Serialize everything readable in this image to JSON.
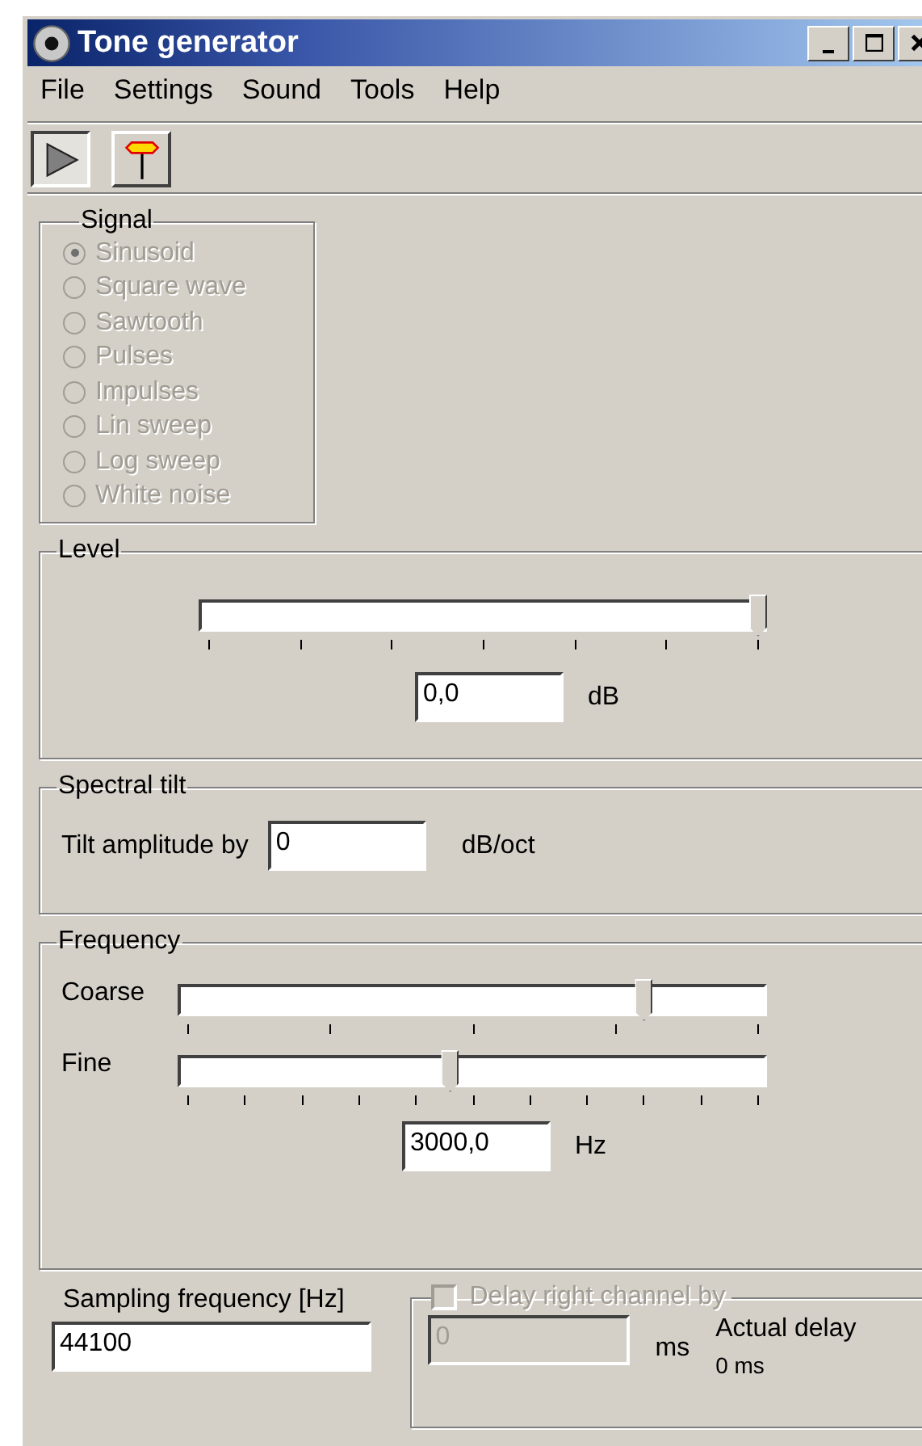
{
  "window": {
    "title": "Tone generator"
  },
  "menu": [
    "File",
    "Settings",
    "Sound",
    "Tools",
    "Help"
  ],
  "toolbar": [
    {
      "kind": "play",
      "pressed": true
    },
    {
      "kind": "signpost",
      "pressed": false
    }
  ],
  "signal": {
    "title": "Signal",
    "disabled": true,
    "options": [
      {
        "label": "Sinusoid",
        "selected": true
      },
      {
        "label": "Square wave",
        "selected": false
      },
      {
        "label": "Sawtooth",
        "selected": false
      },
      {
        "label": "Pulses",
        "selected": false
      },
      {
        "label": "Impulses",
        "selected": false
      },
      {
        "label": "Lin sweep",
        "selected": false
      },
      {
        "label": "Log sweep",
        "selected": false
      },
      {
        "label": "White noise",
        "selected": false
      }
    ]
  },
  "level": {
    "title": "Level",
    "level": 1.0,
    "value": "0,0",
    "unit": "dB"
  },
  "spectral_tilt": {
    "title": "Spectral tilt",
    "label": "Tilt amplitude by",
    "value": "0",
    "unit": "dB/oct"
  },
  "frequency": {
    "title": "Frequency",
    "coarse": {
      "label": "Coarse",
      "level": 0.8
    },
    "fine": {
      "label": "Fine",
      "level": 0.46
    },
    "value": "3000,0",
    "unit": "Hz"
  },
  "sampling": {
    "label": "Sampling frequency [Hz]",
    "value": "44100"
  },
  "delay": {
    "label": "Delay right channel by",
    "checked": false,
    "disabled": true,
    "value": "0",
    "unit": "ms",
    "actual_label": "Actual delay",
    "actual_value": "0 ms"
  }
}
